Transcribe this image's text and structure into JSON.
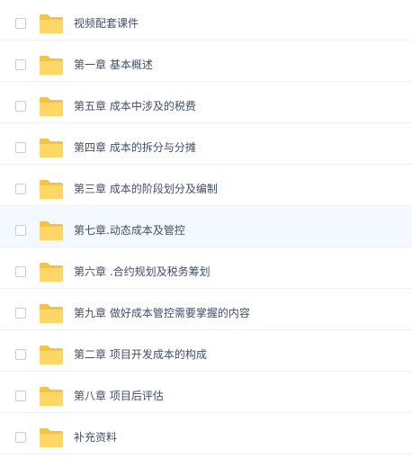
{
  "files": {
    "items": [
      {
        "name": "视频配套课件",
        "icon": "folder-icon"
      },
      {
        "name": "第一章 基本概述",
        "icon": "folder-icon"
      },
      {
        "name": "第五章 成本中涉及的税费",
        "icon": "folder-icon"
      },
      {
        "name": "第四章 成本的拆分与分摊",
        "icon": "folder-icon"
      },
      {
        "name": "第三章 成本的阶段划分及编制",
        "icon": "folder-icon"
      },
      {
        "name": "第七章.动态成本及管控",
        "icon": "folder-icon",
        "hovered": true
      },
      {
        "name": "第六章 .合约规划及税务筹划",
        "icon": "folder-icon"
      },
      {
        "name": "第九章 做好成本管控需要掌握的内容",
        "icon": "folder-icon"
      },
      {
        "name": "第二章 项目开发成本的构成",
        "icon": "folder-icon"
      },
      {
        "name": "第八章 项目后评估",
        "icon": "folder-icon"
      },
      {
        "name": "补充资料",
        "icon": "folder-icon"
      }
    ]
  },
  "colors": {
    "folder_back": "#f5c242",
    "folder_front": "#ffd766",
    "hover_row": "#f4f9ff",
    "text": "#424e67",
    "divider": "#eef0f3"
  }
}
